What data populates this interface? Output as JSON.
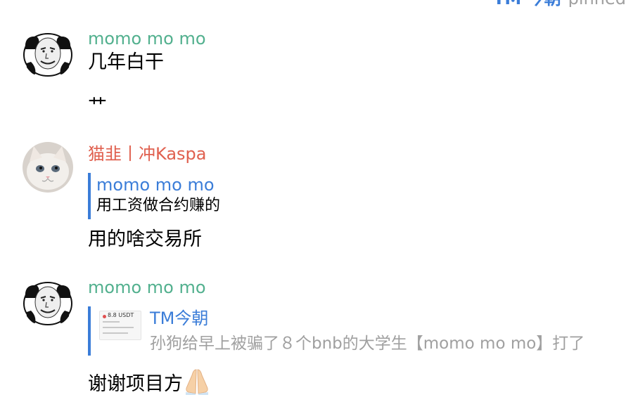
{
  "pinned": {
    "name": "TM 今朝",
    "label": "pinned"
  },
  "messages": [
    {
      "sender": "momo mo mo",
      "sender_color": "#52b08e",
      "lines": [
        "几年白干",
        "艹"
      ]
    },
    {
      "sender": "猫韭丨冲Kaspa",
      "sender_color": "#e0604f",
      "reply": {
        "sender": "momo mo mo",
        "text": "用工资做合约赚的"
      },
      "text": "用的啥交易所"
    },
    {
      "sender": "momo mo mo",
      "sender_color": "#52b08e",
      "reply": {
        "sender": "TM今朝",
        "text": "孙狗给早上被骗了８个bnb的大学生【momo mo mo】打了",
        "thumb_text": "8.8 USDT"
      },
      "text": "谢谢项目方",
      "emoji": "folded-hands-icon"
    }
  ]
}
